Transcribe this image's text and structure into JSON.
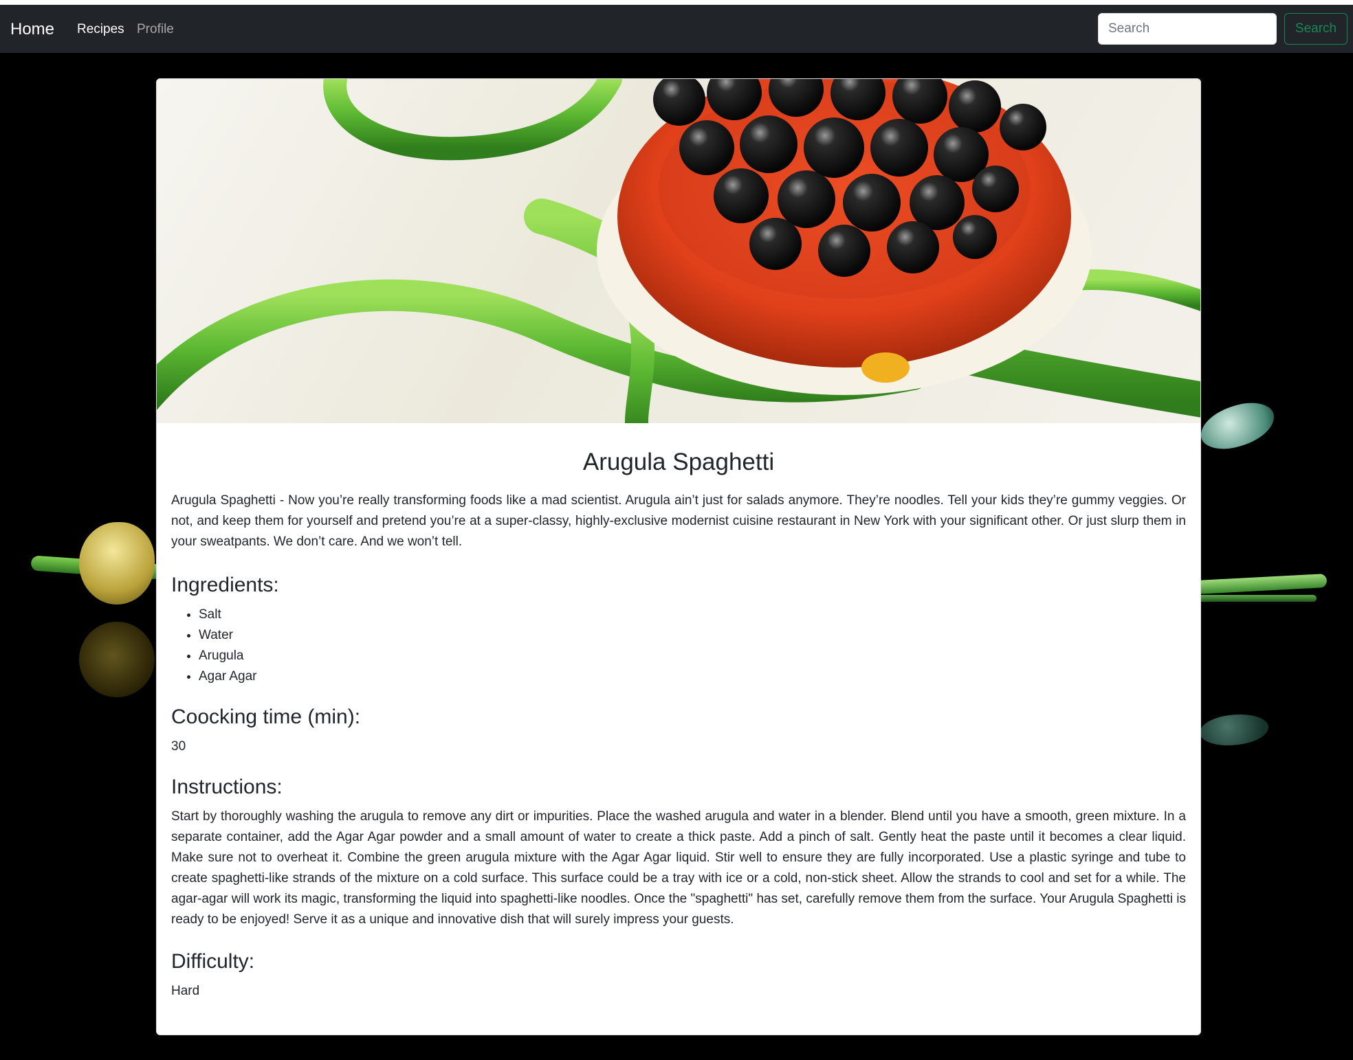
{
  "navbar": {
    "brand": "Home",
    "links": [
      "Recipes",
      "Profile"
    ],
    "search_placeholder": "Search",
    "search_button": "Search"
  },
  "recipe": {
    "title": "Arugula Spaghetti",
    "description": "Arugula Spaghetti - Now you’re really transforming foods like a mad scientist. Arugula ain’t just for salads anymore. They’re noodles. Tell your kids they’re gummy veggies. Or not, and keep them for yourself and pretend you’re at a super-classy, highly-exclusive modernist cuisine restaurant in New York with your significant other. Or just slurp them in your sweatpants. We don’t care. And we won’t tell.",
    "ingredients_heading": "Ingredients:",
    "ingredients": [
      "Salt",
      "Water",
      "Arugula",
      "Agar Agar"
    ],
    "time_heading": "Coocking time (min):",
    "time": "30",
    "instructions_heading": "Instructions:",
    "instructions": "Start by thoroughly washing the arugula to remove any dirt or impurities. Place the washed arugula and water in a blender. Blend until you have a smooth, green mixture. In a separate container, add the Agar Agar powder and a small amount of water to create a thick paste. Add a pinch of salt. Gently heat the paste until it becomes a clear liquid. Make sure not to overheat it. Combine the green arugula mixture with the Agar Agar liquid. Stir well to ensure they are fully incorporated. Use a plastic syringe and tube to create spaghetti-like strands of the mixture on a cold surface. This surface could be a tray with ice or a cold, non-stick sheet. Allow the strands to cool and set for a while. The agar-agar will work its magic, transforming the liquid into spaghetti-like noodles. Once the \"spaghetti\" has set, carefully remove them from the surface. Your Arugula Spaghetti is ready to be enjoyed! Serve it as a unique and innovative dish that will surely impress your guests.",
    "difficulty_heading": "Difficulty:",
    "difficulty": "Hard"
  },
  "colors": {
    "navbar_bg": "#212529",
    "page_bg": "#000000",
    "search_button": "#198754",
    "card_bg": "#ffffff",
    "text": "#212529"
  }
}
